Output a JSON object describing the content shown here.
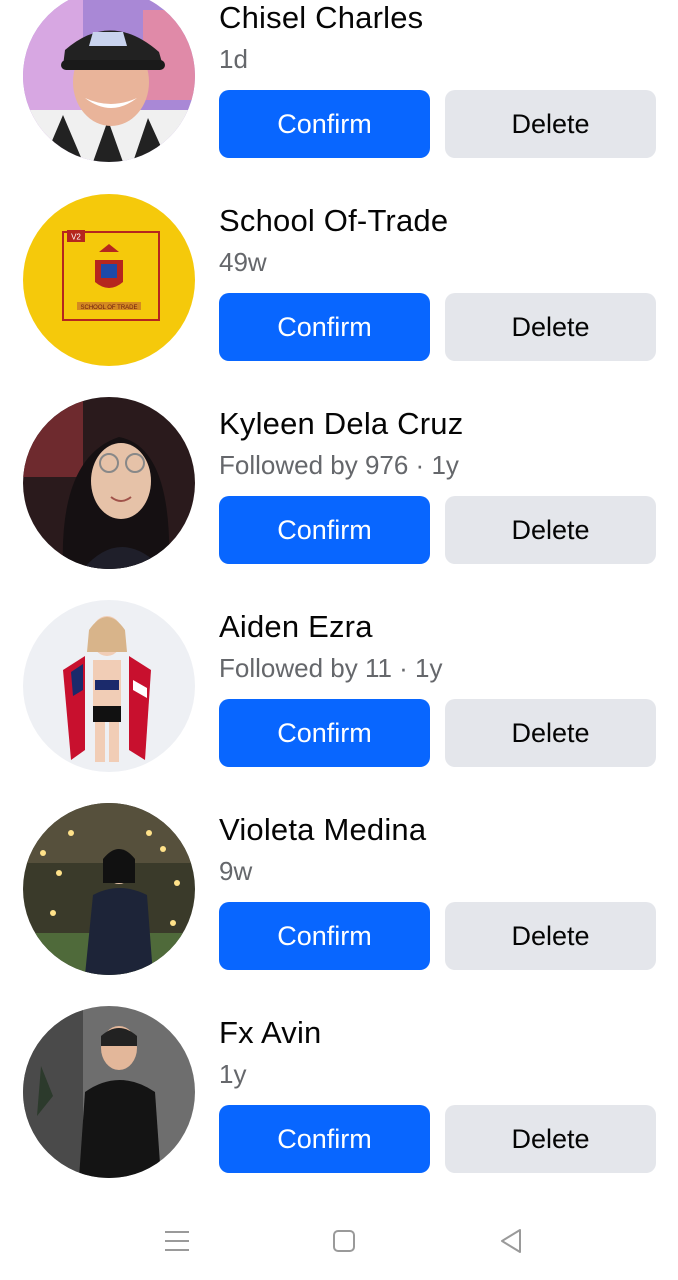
{
  "requests": [
    {
      "name": "Chisel Charles",
      "meta": "1d",
      "confirm_label": "Confirm",
      "delete_label": "Delete"
    },
    {
      "name": "School Of-Trade",
      "meta": "49w",
      "confirm_label": "Confirm",
      "delete_label": "Delete",
      "avatar_text": {
        "badge": "V2",
        "caption": "SCHOOL OF TRADE"
      }
    },
    {
      "name": "Kyleen Dela Cruz",
      "meta": "Followed by 976 · 1y",
      "confirm_label": "Confirm",
      "delete_label": "Delete"
    },
    {
      "name": "Aiden Ezra",
      "meta": "Followed by 11 · 1y",
      "confirm_label": "Confirm",
      "delete_label": "Delete"
    },
    {
      "name": "Violeta Medina",
      "meta": "9w",
      "confirm_label": "Confirm",
      "delete_label": "Delete"
    },
    {
      "name": "Fx Avin",
      "meta": "1y",
      "confirm_label": "Confirm",
      "delete_label": "Delete"
    }
  ],
  "colors": {
    "confirm_bg": "#0866ff",
    "delete_bg": "#e4e6eb",
    "meta_text": "#65676b"
  },
  "navbar": {
    "icons": [
      "menu-icon",
      "home-square-icon",
      "back-triangle-icon"
    ]
  }
}
